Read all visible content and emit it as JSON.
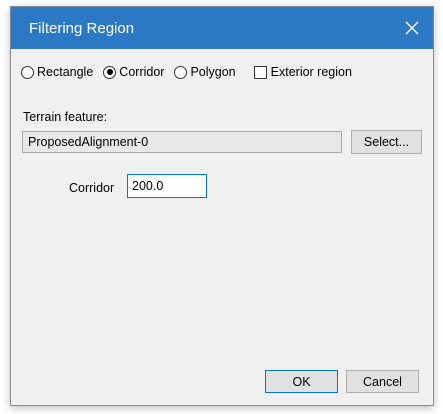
{
  "window": {
    "title": "Filtering Region",
    "close_icon": "close-icon"
  },
  "region_type": {
    "options": [
      {
        "label": "Rectangle",
        "checked": false
      },
      {
        "label": "Corridor",
        "checked": true
      },
      {
        "label": "Polygon",
        "checked": false
      }
    ],
    "exterior": {
      "label": "Exterior region",
      "checked": false
    }
  },
  "terrain": {
    "label": "Terrain feature:",
    "value": "ProposedAlignment-0",
    "select_label": "Select..."
  },
  "corridor": {
    "label": "Corridor",
    "value": "200.0"
  },
  "buttons": {
    "ok_label": "OK",
    "cancel_label": "Cancel"
  },
  "colors": {
    "titlebar": "#2b78c5",
    "dialog_bg": "#f0f0f0",
    "focus_border": "#0078d7"
  }
}
